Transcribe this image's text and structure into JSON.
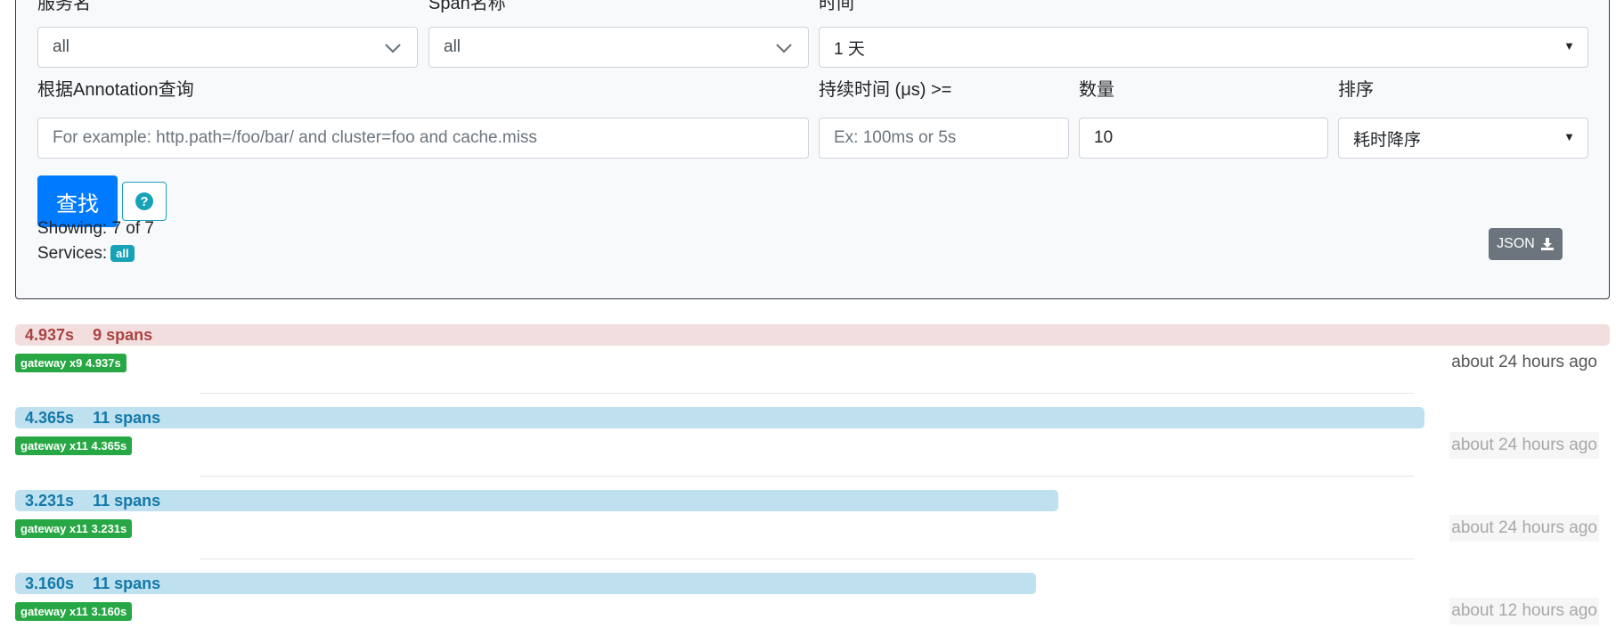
{
  "form": {
    "service_label": "服务名",
    "service_value": "all",
    "span_label": "Span名称",
    "span_value": "all",
    "time_label": "时间",
    "time_value": "1 天",
    "annotation_label": "根据Annotation查询",
    "annotation_placeholder": "For example: http.path=/foo/bar/ and cluster=foo and cache.miss",
    "duration_label": "持续时间 (μs) >=",
    "duration_placeholder": "Ex: 100ms or 5s",
    "limit_label": "数量",
    "limit_value": "10",
    "sort_label": "排序",
    "sort_value": "耗时降序",
    "search_button": "查找",
    "help_button_icon": "question-circle-icon",
    "showing_text": "Showing: 7 of 7",
    "services_label": "Services:",
    "services_badge": "all",
    "json_button": "JSON",
    "json_button_icon": "download-icon"
  },
  "traces": [
    {
      "duration": "4.937s",
      "spans": "9 spans",
      "service_badge": "gateway x9 4.937s",
      "time_ago": "about 24 hours ago",
      "bar_fraction": 1.0,
      "status": "error"
    },
    {
      "duration": "4.365s",
      "spans": "11 spans",
      "service_badge": "gateway x11 4.365s",
      "time_ago": "about 24 hours ago",
      "bar_fraction": 0.884,
      "status": "ok"
    },
    {
      "duration": "3.231s",
      "spans": "11 spans",
      "service_badge": "gateway x11 3.231s",
      "time_ago": "about 24 hours ago",
      "bar_fraction": 0.654,
      "status": "ok"
    },
    {
      "duration": "3.160s",
      "spans": "11 spans",
      "service_badge": "gateway x11 3.160s",
      "time_ago": "about 12 hours ago",
      "bar_fraction": 0.64,
      "status": "ok"
    }
  ],
  "colors": {
    "primary": "#007bff",
    "info": "#17a2b8",
    "success": "#28a745",
    "error_bar": "#f2dede",
    "ok_bar": "#bee0ef"
  }
}
